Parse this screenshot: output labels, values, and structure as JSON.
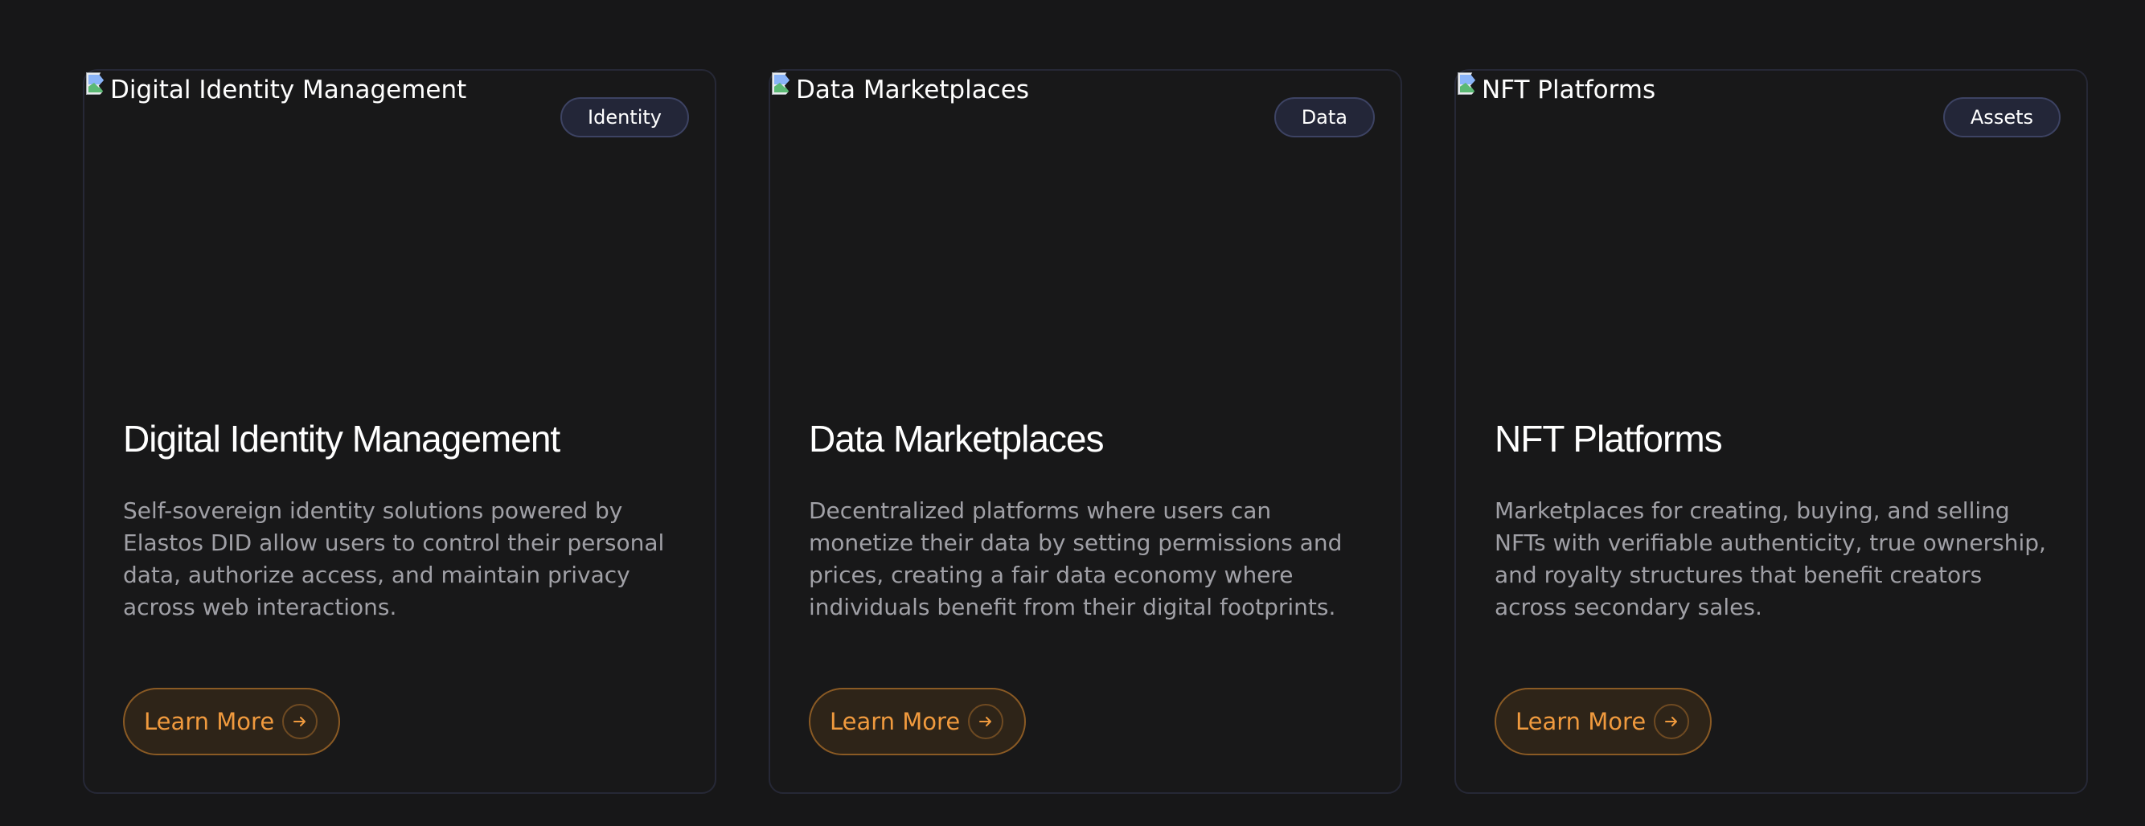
{
  "cards": [
    {
      "image_alt": "Digital Identity Management",
      "badge": "Identity",
      "title": "Digital Identity Management",
      "description": "Self-sovereign identity solutions powered by Elastos DID allow users to control their personal data, authorize access, and maintain privacy across web interactions.",
      "cta": "Learn More",
      "cta_icon": "arrow-right-icon"
    },
    {
      "image_alt": "Data Marketplaces",
      "badge": "Data",
      "title": "Data Marketplaces",
      "description": "Decentralized platforms where users can monetize their data by setting permissions and prices, creating a fair data economy where individuals benefit from their digital footprints.",
      "cta": "Learn More",
      "cta_icon": "arrow-right-icon"
    },
    {
      "image_alt": "NFT Platforms",
      "badge": "Assets",
      "title": "NFT Platforms",
      "description": "Marketplaces for creating, buying, and selling NFTs with verifiable authenticity, true ownership, and royalty structures that benefit creators across secondary sales.",
      "cta": "Learn More",
      "cta_icon": "arrow-right-icon"
    }
  ],
  "colors": {
    "background": "#171718",
    "card_border": "#262836",
    "badge_bg": "#232638",
    "accent": "#f09a3e",
    "muted_text": "#a0a0a6"
  }
}
